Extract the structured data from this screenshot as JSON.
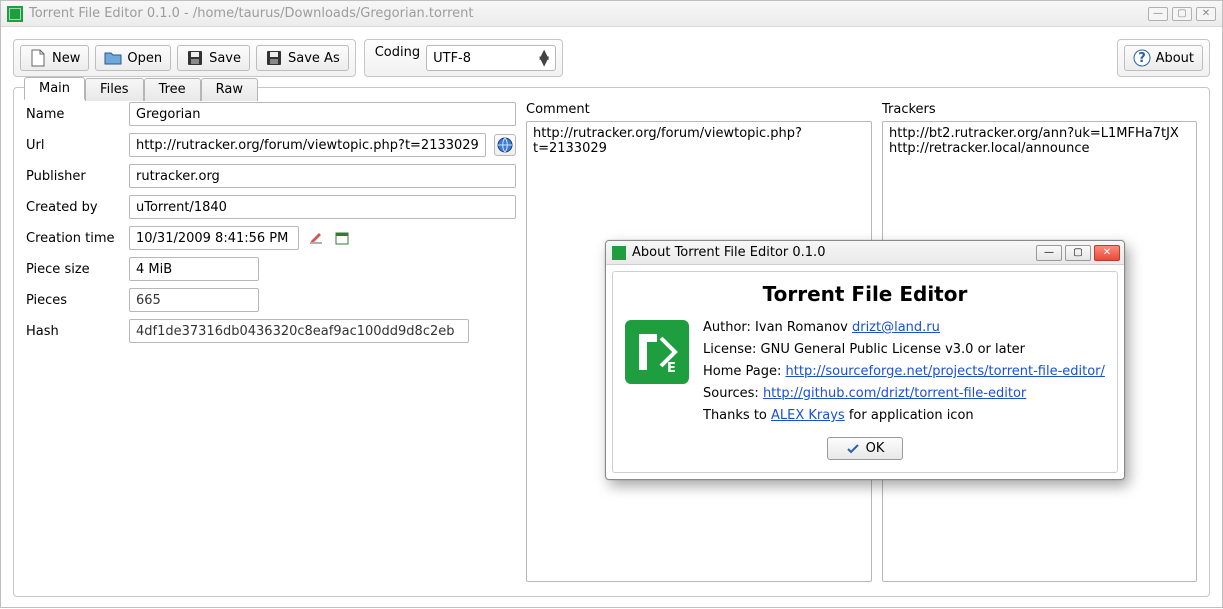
{
  "window": {
    "title": "Torrent File Editor 0.1.0 - /home/taurus/Downloads/Gregorian.torrent",
    "min": "—",
    "max": "▢",
    "close": "✕"
  },
  "toolbar": {
    "new": "New",
    "open": "Open",
    "save": "Save",
    "saveas": "Save As",
    "coding_label": "Coding",
    "coding_value": "UTF-8",
    "about": "About"
  },
  "tabs": {
    "main": "Main",
    "files": "Files",
    "tree": "Tree",
    "raw": "Raw"
  },
  "form": {
    "name_label": "Name",
    "name": "Gregorian",
    "url_label": "Url",
    "url": "http://rutracker.org/forum/viewtopic.php?t=2133029",
    "publisher_label": "Publisher",
    "publisher": "rutracker.org",
    "createdby_label": "Created by",
    "createdby": "uTorrent/1840",
    "ctime_label": "Creation time",
    "ctime": "10/31/2009 8:41:56 PM",
    "piecesize_label": "Piece size",
    "piecesize": "4 MiB",
    "pieces_label": "Pieces",
    "pieces": "665",
    "hash_label": "Hash",
    "hash": "4df1de37316db0436320c8eaf9ac100dd9d8c2eb"
  },
  "comment": {
    "label": "Comment",
    "value": "http://rutracker.org/forum/viewtopic.php?t=2133029"
  },
  "trackers": {
    "label": "Trackers",
    "value": "http://bt2.rutracker.org/ann?uk=L1MFHa7tJX\nhttp://retracker.local/announce"
  },
  "about": {
    "title": "About Torrent File Editor 0.1.0",
    "heading": "Torrent File Editor",
    "author_label": "Author: Ivan Romanov ",
    "author_email": "drizt@land.ru",
    "license": "License: GNU General Public License v3.0 or later",
    "homepage_label": "Home Page: ",
    "homepage": "http://sourceforge.net/projects/torrent-file-editor/",
    "sources_label": "Sources: ",
    "sources": "http://github.com/drizt/torrent-file-editor",
    "thanks_pre": "Thanks to ",
    "thanks_link": "ALEX Krays",
    "thanks_post": " for application icon",
    "ok": "OK"
  }
}
